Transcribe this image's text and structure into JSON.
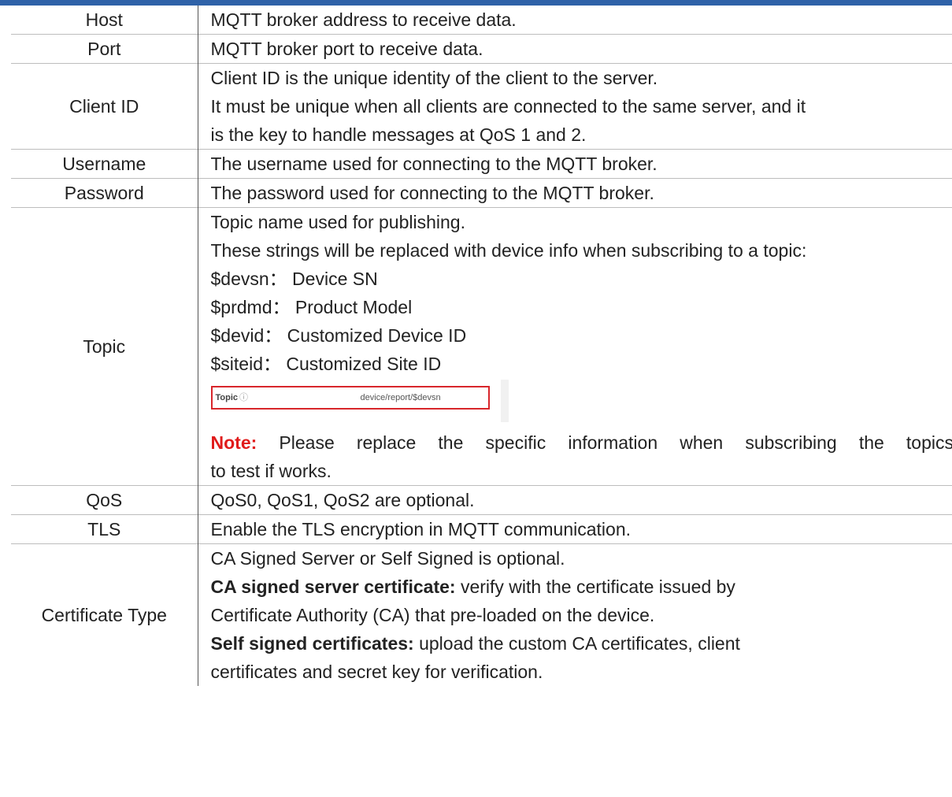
{
  "rows": [
    {
      "name": "Host",
      "lines": [
        "MQTT broker address to receive data."
      ]
    },
    {
      "name": "Port",
      "lines": [
        "MQTT broker port to receive data."
      ]
    },
    {
      "name": "Client ID",
      "lines": [
        "Client ID is the unique identity of the client to the server.",
        "It must be unique when all clients are connected to the same server, and it",
        "is the key to handle messages at QoS 1 and 2."
      ]
    },
    {
      "name": "Username",
      "lines": [
        "The username used for connecting to the MQTT broker."
      ]
    },
    {
      "name": "Password",
      "lines": [
        "The password used for connecting to the MQTT broker."
      ]
    },
    {
      "name": "Topic",
      "lines": [
        "Topic name used for publishing.",
        "These strings will be replaced with device info when subscribing to a topic:",
        "$devsn： Device SN",
        "$prdmd： Product Model",
        "$devid： Customized Device ID",
        "$siteid： Customized Site ID"
      ],
      "screenshot": {
        "label": "Topic",
        "info_icon": "ⓘ",
        "value": "device/report/$devsn"
      },
      "note": {
        "label": "Note:",
        "line1": " Please replace the specific information when subscribing the topics",
        "line2": "to test if works."
      }
    },
    {
      "name": "QoS",
      "lines": [
        "QoS0, QoS1, QoS2 are optional."
      ]
    },
    {
      "name": "TLS",
      "lines": [
        "Enable the TLS encryption in MQTT communication."
      ]
    },
    {
      "name": "Certificate Type",
      "lines": [
        "CA Signed Server or Self Signed is optional."
      ],
      "ca": {
        "label": "CA signed server certificate:",
        "text1": " verify with the certificate issued by",
        "text2": "Certificate Authority (CA) that pre-loaded on the device."
      },
      "self": {
        "label": "Self signed certificates:",
        "text1": " upload the custom CA certificates, client",
        "text2": "certificates and secret key for verification."
      }
    }
  ],
  "colors": {
    "header_bar": "#2f62a8",
    "note_label": "#e01b1b",
    "screenshot_border": "#d8262b"
  }
}
